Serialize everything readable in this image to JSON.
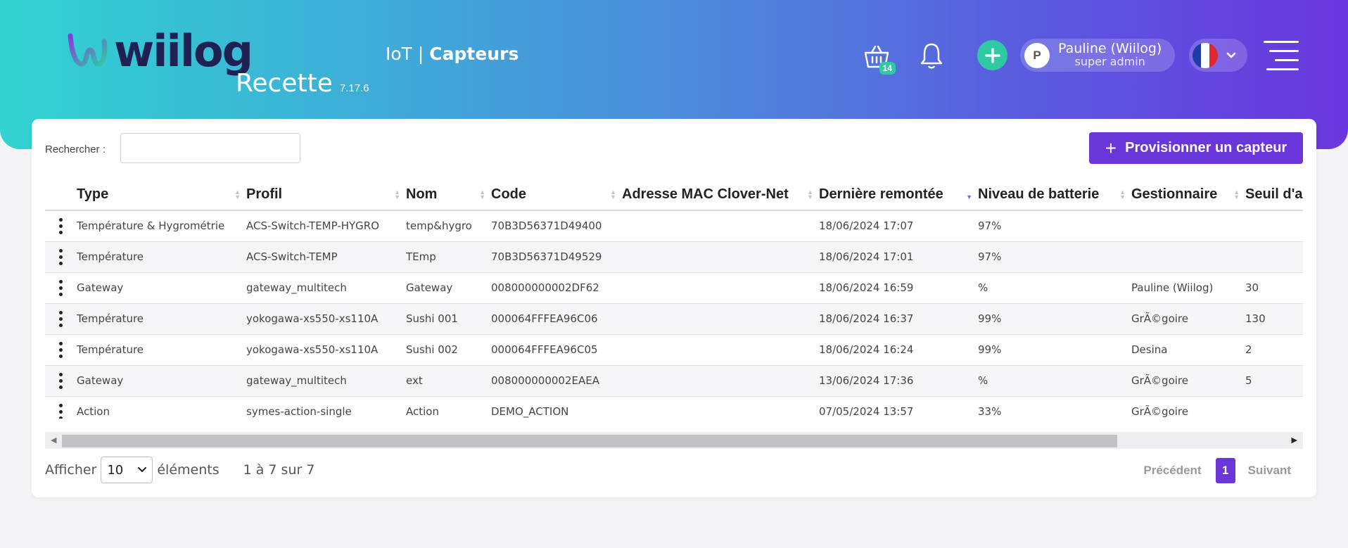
{
  "header": {
    "brand": "wiilog",
    "environment": "Recette",
    "version": "7.17.6",
    "breadcrumb_section": "IoT",
    "breadcrumb_separator": "|",
    "breadcrumb_page": "Capteurs",
    "cart_count": "14",
    "user_initial": "P",
    "user_name": "Pauline (Wiilog)",
    "user_role": "super admin",
    "colors": {
      "accent": "#6a35d9",
      "success": "#2fc9a3",
      "brand_dark": "#1e2151"
    }
  },
  "search": {
    "label": "Rechercher :",
    "value": "",
    "placeholder": ""
  },
  "actions": {
    "provision_label": "Provisionner un capteur"
  },
  "table": {
    "columns": [
      "",
      "Type",
      "Profil",
      "Nom",
      "Code",
      "Adresse MAC Clover-Net",
      "Dernière remontée",
      "Niveau de batterie",
      "Gestionnaire",
      "Seuil d'a"
    ],
    "rows": [
      [
        "Température & Hygrométrie",
        "ACS-Switch-TEMP-HYGRO",
        "temp&hygro",
        "70B3D56371D49400",
        "",
        "18/06/2024 17:07",
        "97%",
        "",
        ""
      ],
      [
        "Température",
        "ACS-Switch-TEMP",
        "TEmp",
        "70B3D56371D49529",
        "",
        "18/06/2024 17:01",
        "97%",
        "",
        ""
      ],
      [
        "Gateway",
        "gateway_multitech",
        "Gateway",
        "008000000002DF62",
        "",
        "18/06/2024 16:59",
        "%",
        "Pauline (Wiilog)",
        "30"
      ],
      [
        "Température",
        "yokogawa-xs550-xs110A",
        "Sushi 001",
        "000064FFFEA96C06",
        "",
        "18/06/2024 16:37",
        "99%",
        "GrÃ©goire",
        "130"
      ],
      [
        "Température",
        "yokogawa-xs550-xs110A",
        "Sushi 002",
        "000064FFFEA96C05",
        "",
        "18/06/2024 16:24",
        "99%",
        "Desina",
        "2"
      ],
      [
        "Gateway",
        "gateway_multitech",
        "ext",
        "008000000002EAEA",
        "",
        "13/06/2024 17:36",
        "%",
        "GrÃ©goire",
        "5"
      ],
      [
        "Action",
        "symes-action-single",
        "Action",
        "DEMO_ACTION",
        "",
        "07/05/2024 13:57",
        "33%",
        "GrÃ©goire",
        ""
      ]
    ],
    "sorted_column": "Dernière remontée",
    "sort_direction": "desc"
  },
  "footer": {
    "show_label": "Afficher",
    "page_size": "10",
    "elements_label": "éléments",
    "info": "1 à 7 sur 7",
    "previous": "Précédent",
    "current_page": "1",
    "next": "Suivant"
  }
}
